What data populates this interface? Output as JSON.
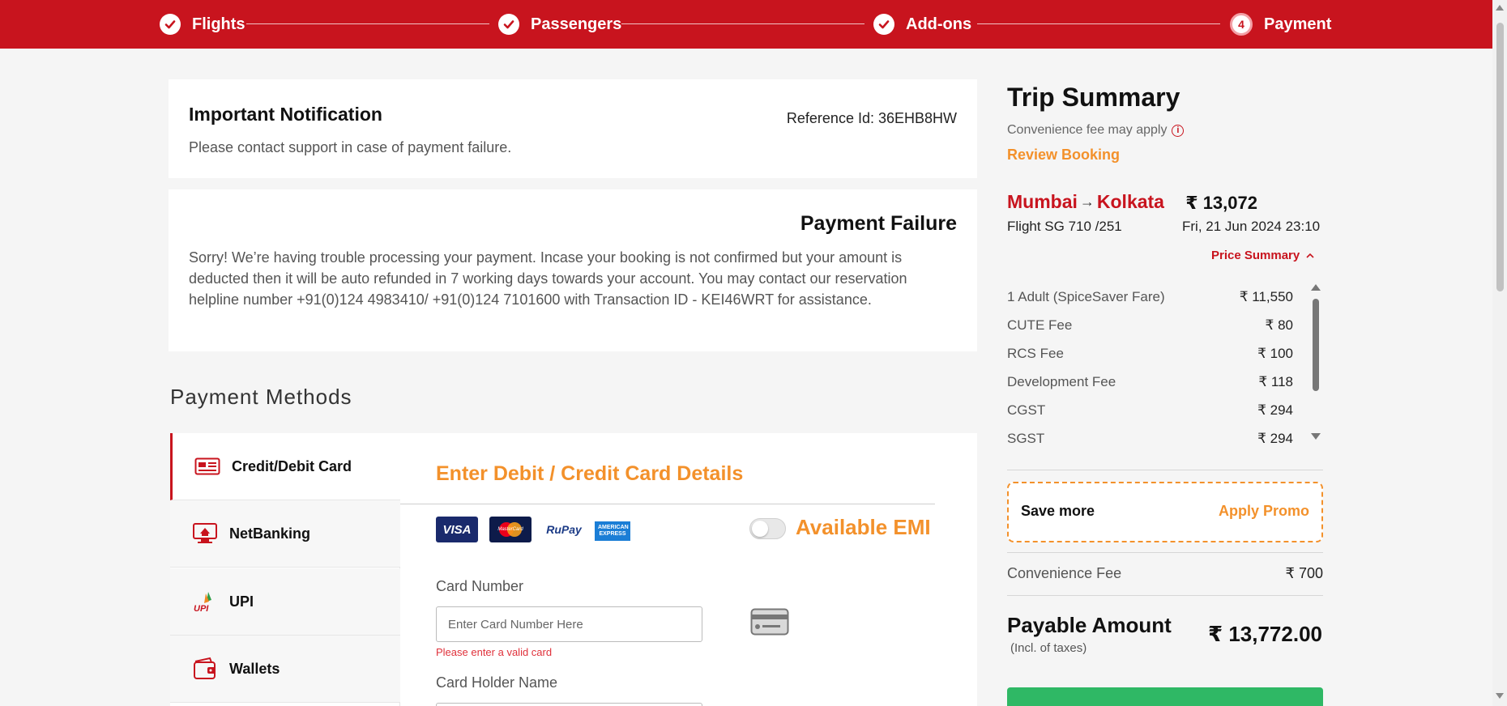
{
  "stepper": {
    "steps": [
      {
        "label": "Flights",
        "state": "done"
      },
      {
        "label": "Passengers",
        "state": "done"
      },
      {
        "label": "Add-ons",
        "state": "done"
      },
      {
        "label": "Payment",
        "state": "current",
        "number": "4"
      }
    ]
  },
  "notification": {
    "title": "Important Notification",
    "reference": "Reference Id: 36EHB8HW",
    "message": "Please contact support in case of payment failure."
  },
  "failure": {
    "title": "Payment Failure",
    "message": "Sorry! We’re having trouble processing your payment. Incase your booking is not confirmed but your amount is deducted then it will be auto refunded in 7 working days towards your account. You may contact our reservation helpline number +91(0)124 4983410/ +91(0)124 7101600  with Transaction ID - KEI46WRT for assistance."
  },
  "payment_methods": {
    "title": "Payment Methods",
    "tabs": [
      {
        "label": "Credit/Debit Card",
        "icon": "card-icon",
        "active": true
      },
      {
        "label": "NetBanking",
        "icon": "netbanking-icon",
        "active": false
      },
      {
        "label": "UPI",
        "icon": "upi-icon",
        "active": false
      },
      {
        "label": "Wallets",
        "icon": "wallet-icon",
        "active": false
      }
    ]
  },
  "card_details": {
    "title": "Enter Debit / Credit Card Details",
    "logos": [
      "VISA",
      "MasterCard",
      "RuPay",
      "AMERICAN EXPRESS"
    ],
    "emi_label": "Available EMI",
    "emi_enabled": false,
    "card_number_label": "Card Number",
    "card_number_placeholder": "Enter Card Number Here",
    "card_number_error": "Please enter a valid card",
    "card_holder_label": "Card Holder Name"
  },
  "trip_summary": {
    "title": "Trip Summary",
    "convenience_note": "Convenience fee may apply",
    "review_link": "Review Booking",
    "origin": "Mumbai",
    "destination": "Kolkata",
    "fare": "₹ 13,072",
    "flight": "Flight  SG 710 /251",
    "datetime": "Fri, 21 Jun 2024 23:10",
    "price_summary_label": "Price Summary",
    "fare_items": [
      {
        "label": "1 Adult  (SpiceSaver Fare)",
        "amount": "₹ 11,550"
      },
      {
        "label": "CUTE Fee",
        "amount": "₹ 80"
      },
      {
        "label": "RCS Fee",
        "amount": "₹ 100"
      },
      {
        "label": "Development Fee",
        "amount": "₹ 118"
      },
      {
        "label": "CGST",
        "amount": "₹ 294"
      },
      {
        "label": "SGST",
        "amount": "₹ 294"
      }
    ],
    "promo_text": "Save more",
    "promo_link": "Apply Promo",
    "convenience_fee_label": "Convenience Fee",
    "convenience_fee": "₹ 700",
    "payable_label": "Payable Amount",
    "payable_note": "(Incl. of taxes)",
    "payable_amount": "₹ 13,772.00"
  },
  "colors": {
    "brand_red": "#c8141e",
    "accent_orange": "#f3912b",
    "pay_green": "#2fb865"
  }
}
